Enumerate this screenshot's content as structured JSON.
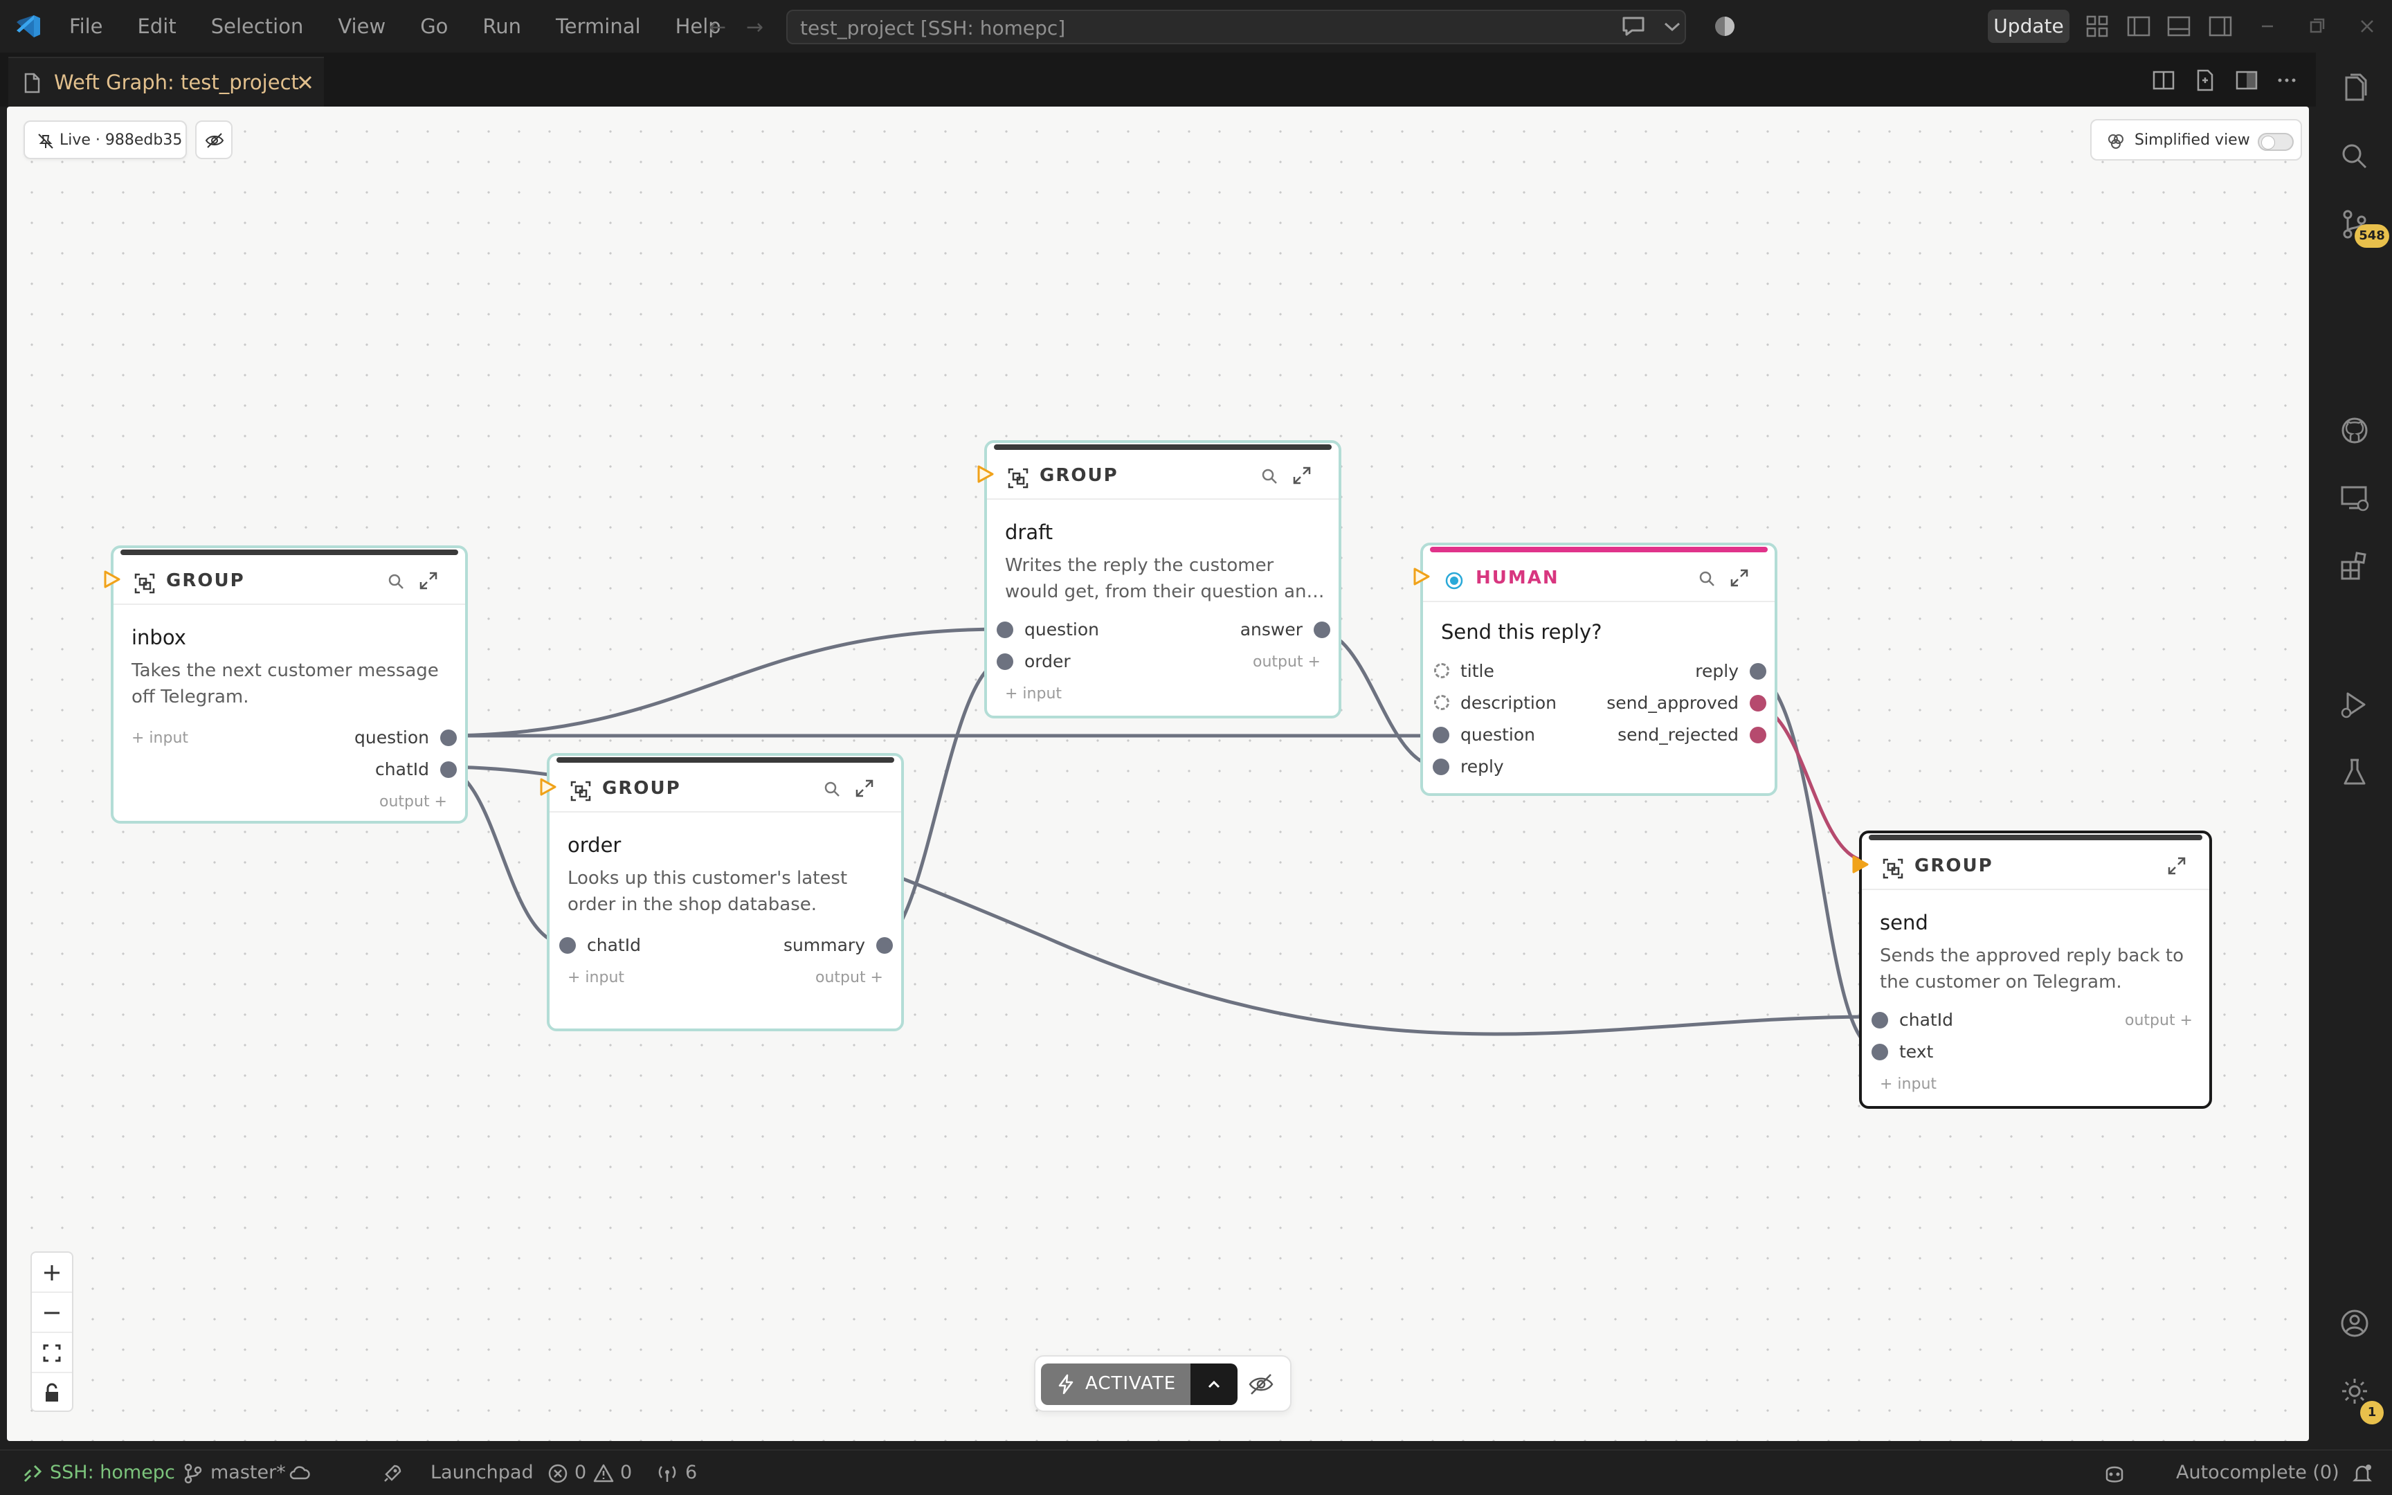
{
  "window": {
    "title": "test_project [SSH: homepc]",
    "menu": [
      "File",
      "Edit",
      "Selection",
      "View",
      "Go",
      "Run",
      "Terminal",
      "Help"
    ],
    "update_label": "Update"
  },
  "tab": {
    "label": "Weft Graph: test_project"
  },
  "canvas": {
    "live_label": "Live · 988edb35",
    "simplified_label": "Simplified view",
    "activate_label": "ACTIVATE"
  },
  "nodes": {
    "inbox": {
      "type": "GROUP",
      "title": "inbox",
      "description": "Takes the next customer message off Telegram.",
      "inputs": [],
      "outputs": [
        "question",
        "chatId"
      ],
      "add_input": "+ input",
      "add_output": "output +"
    },
    "draft": {
      "type": "GROUP",
      "title": "draft",
      "description": "Writes the reply the customer would get, from their question an…",
      "inputs": [
        "question",
        "order"
      ],
      "outputs": [
        "answer"
      ],
      "add_input": "+ input",
      "add_output": "output +"
    },
    "order": {
      "type": "GROUP",
      "title": "order",
      "description": "Looks up this customer's latest order in the shop database.",
      "inputs": [
        "chatId"
      ],
      "outputs": [
        "summary"
      ],
      "add_input": "+ input",
      "add_output": "output +"
    },
    "human": {
      "type": "HUMAN",
      "title": "Send this reply?",
      "inputs": [
        "title",
        "description",
        "question",
        "reply"
      ],
      "outputs": [
        "reply",
        "send_approved",
        "send_rejected"
      ],
      "accent": "#d8367f"
    },
    "send": {
      "type": "GROUP",
      "title": "send",
      "description": "Sends the approved reply back to the customer on Telegram.",
      "inputs": [
        "chatId",
        "text"
      ],
      "outputs": [],
      "add_input": "+ input",
      "add_output": "output +"
    }
  },
  "activity_badges": {
    "source_control": "548",
    "settings": "1"
  },
  "status": {
    "remote": "SSH: homepc",
    "branch": "master*",
    "launchpad": "Launchpad",
    "errors": "0",
    "warnings": "0",
    "ports": "6",
    "autocomplete": "Autocomplete (0)"
  },
  "colors": {
    "accent_teal": "#b3ddd6",
    "human_pink": "#e0338a",
    "trigger_orange": "#f0a21a",
    "wire": "#6d7280",
    "tab_text": "#e2c08d"
  }
}
